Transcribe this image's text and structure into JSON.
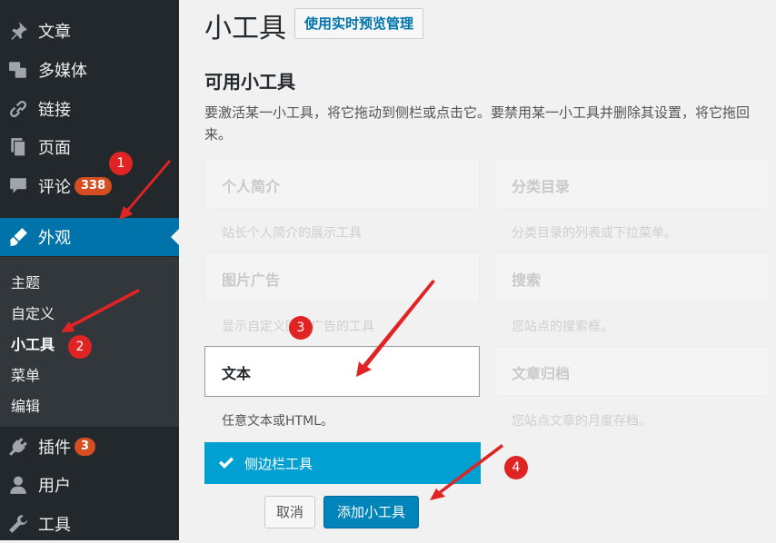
{
  "sidebar": {
    "items": [
      {
        "label": "文章",
        "icon": "pin-icon"
      },
      {
        "label": "多媒体",
        "icon": "media-icon"
      },
      {
        "label": "链接",
        "icon": "link-icon"
      },
      {
        "label": "页面",
        "icon": "page-icon"
      },
      {
        "label": "评论",
        "icon": "comment-icon",
        "badge": "338"
      },
      {
        "label": "外观",
        "icon": "brush-icon",
        "current": true
      },
      {
        "label": "插件",
        "icon": "plugin-icon",
        "badge": "3"
      },
      {
        "label": "用户",
        "icon": "user-icon"
      },
      {
        "label": "工具",
        "icon": "wrench-icon"
      }
    ],
    "submenu": [
      "主题",
      "自定义",
      "小工具",
      "菜单",
      "编辑"
    ],
    "active_submenu": "小工具"
  },
  "main": {
    "title": "小工具",
    "manage_button": "使用实时预览管理",
    "section_title": "可用小工具",
    "description": "要激活某一小工具，将它拖动到侧栏或点击它。要禁用某一小工具并删除其设置，将它拖回来。",
    "widgets": [
      {
        "title": "个人简介",
        "desc": "站长个人简介的展示工具"
      },
      {
        "title": "分类目录",
        "desc": "分类目录的列表或下拉菜单。"
      },
      {
        "title": "图片广告",
        "desc": "显示自定义图片广告的工具"
      },
      {
        "title": "搜索",
        "desc": "您站点的搜索框。"
      },
      {
        "title": "文本",
        "desc": "任意文本或HTML。",
        "active": true
      },
      {
        "title": "文章归档",
        "desc": "您站点文章的月度存档。"
      }
    ],
    "sidebar_choice": "侧边栏工具",
    "cancel_button": "取消",
    "add_button": "添加小工具"
  },
  "annotations": {
    "steps": [
      "1",
      "2",
      "3",
      "4"
    ]
  },
  "colors": {
    "admin_bar": "#23282d",
    "submenu": "#32373c",
    "accent": "#0073aa",
    "choice": "#00a0d2",
    "primary_button": "#0085ba",
    "badge": "#d54e21",
    "annotation": "#e02424"
  }
}
